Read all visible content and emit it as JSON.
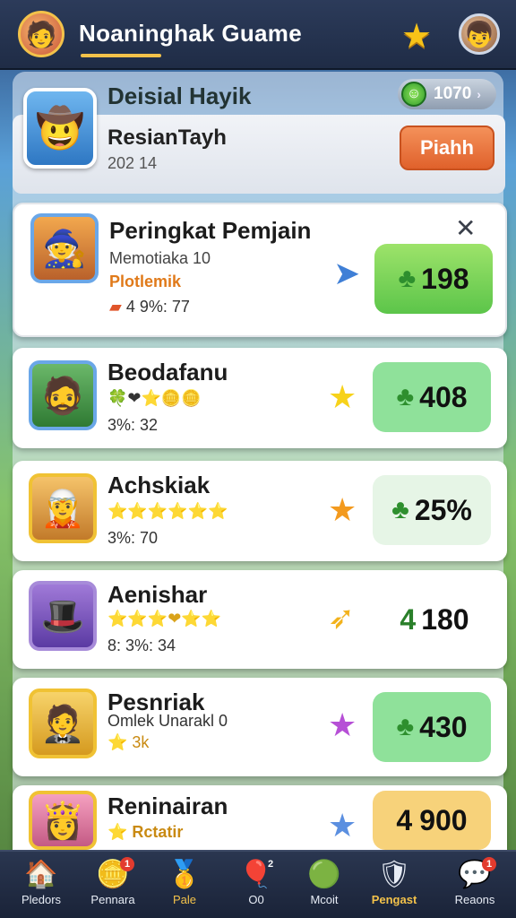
{
  "topbar": {
    "app_title": "Noaninghak Guame",
    "left_avatar_icon": "player-avatar-icon",
    "star_icon": "star-icon",
    "right_avatar_icon": "profile-avatar-icon"
  },
  "header": {
    "title": "Deisial Hayik",
    "coin_balance": "1070"
  },
  "profile": {
    "name": "ResianTayh",
    "subtitle": "202 14",
    "action_label": "Piahh"
  },
  "featured": {
    "name": "Peringkat Pemjain",
    "line1": "Memotiaka 10",
    "line2": "Plotlemik",
    "line3": "4  9%:  77",
    "score": "198",
    "close_icon": "close-icon"
  },
  "players": [
    {
      "name": "Beodafanu",
      "line1": "🍀❤⭐🪙🪙",
      "line2": "3%:  32",
      "score": "408",
      "star_color": "#f7d21a",
      "score_bg": "#8fe19a"
    },
    {
      "name": "Achskiak",
      "line1": "⭐⭐⭐⭐⭐⭐",
      "line2": "3%:  70",
      "score": "25%",
      "star_color": "#f39a1e",
      "score_bg": "#e6f5e6"
    },
    {
      "name": "Aenishar",
      "line1": "⭐⭐⭐❤⭐⭐",
      "line2": "8:  3%:  34",
      "score": "180",
      "star_color": "#f2b21c",
      "score_bg": "#ffffff"
    },
    {
      "name": "Pesnriak",
      "line1": "Omlek Unarakl 0",
      "line2": "⭐ 3k",
      "score": "430",
      "star_color": "#b64fd6",
      "score_bg": "#8fe19a"
    },
    {
      "name": "Reninairan",
      "line1": "⭐ Rctatir",
      "line2": "",
      "score": "900",
      "score_prefix": "4",
      "star_color": "#5b8fe0",
      "score_bg": "#f7d27a"
    }
  ],
  "nav": [
    {
      "label": "Pledors",
      "icon": "home-icon",
      "badge": ""
    },
    {
      "label": "Pennara",
      "icon": "coin-icon",
      "badge": "1"
    },
    {
      "label": "Pale",
      "icon": "gold-icon",
      "badge": ""
    },
    {
      "label": "O0",
      "icon": "balloon-icon",
      "badge": "2"
    },
    {
      "label": "Mcoit",
      "icon": "medal-icon",
      "badge": ""
    },
    {
      "label": "Pengast",
      "icon": "shield-icon",
      "badge": "",
      "active": true
    },
    {
      "label": "Reaons",
      "icon": "chat-icon",
      "badge": "1"
    }
  ],
  "colors": {
    "accent": "#f3c24a",
    "action": "#e86b35",
    "score_green": "#8fe19a"
  }
}
